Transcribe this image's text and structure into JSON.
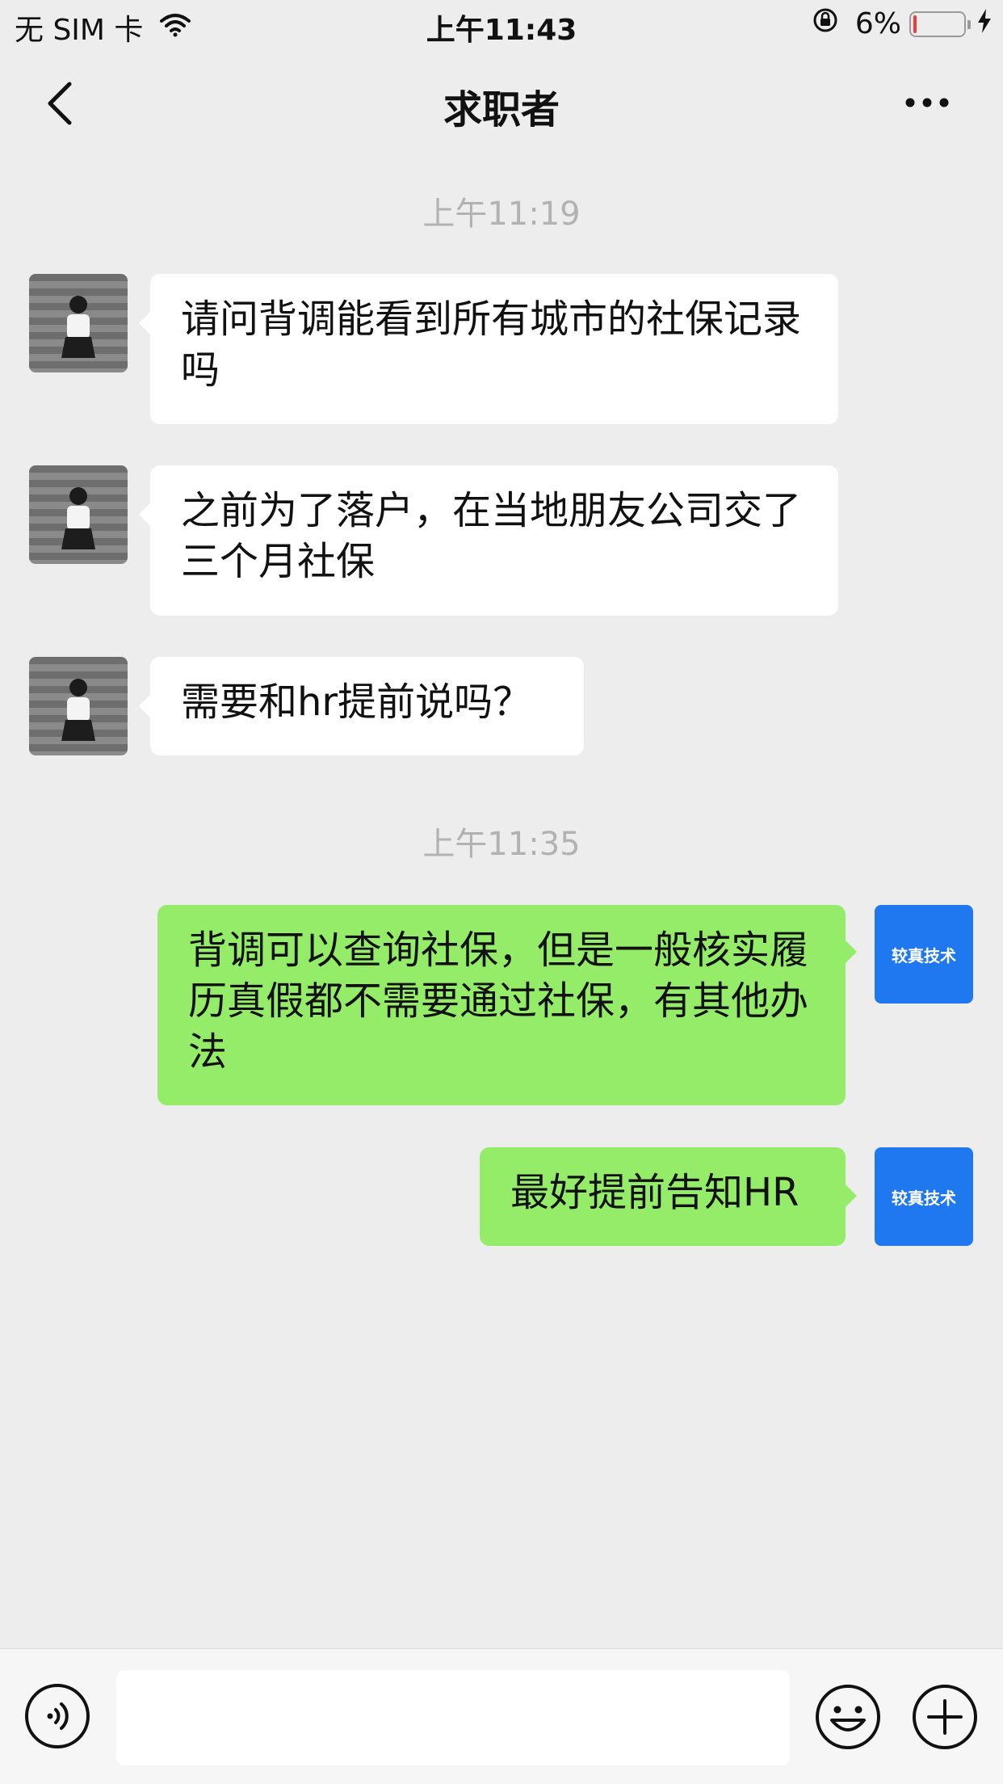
{
  "status": {
    "carrier": "无 SIM 卡",
    "time": "上午11:43",
    "battery": "6%",
    "battery_level": 0.06,
    "battery_color": "#f23b3b"
  },
  "nav": {
    "title": "求职者",
    "icons": {
      "back": "chevron-left-icon",
      "more": "ellipsis-icon"
    }
  },
  "chat": {
    "timestamps": [
      "上午11:19",
      "上午11:35"
    ],
    "incoming": [
      {
        "text": "请问背调能看到所有城市的社保记录吗"
      },
      {
        "text": "之前为了落户，在当地朋友公司交了三个月社保"
      },
      {
        "text": "需要和hr提前说吗？"
      }
    ],
    "outgoing": [
      {
        "text": "背调可以查询社保，但是一般核实履历真假都不需要通过社保，有其他办法"
      },
      {
        "text": "最好提前告知HR"
      }
    ],
    "brand_avatar_label": "较真技术"
  },
  "colors": {
    "background": "#ededed",
    "incoming_bubble": "#ffffff",
    "outgoing_bubble": "#95ec69",
    "brand": "#1f78f0"
  },
  "input": {
    "placeholder": "",
    "icons": {
      "voice": "voice-icon",
      "emoji": "emoji-icon",
      "plus": "plus-icon"
    }
  }
}
